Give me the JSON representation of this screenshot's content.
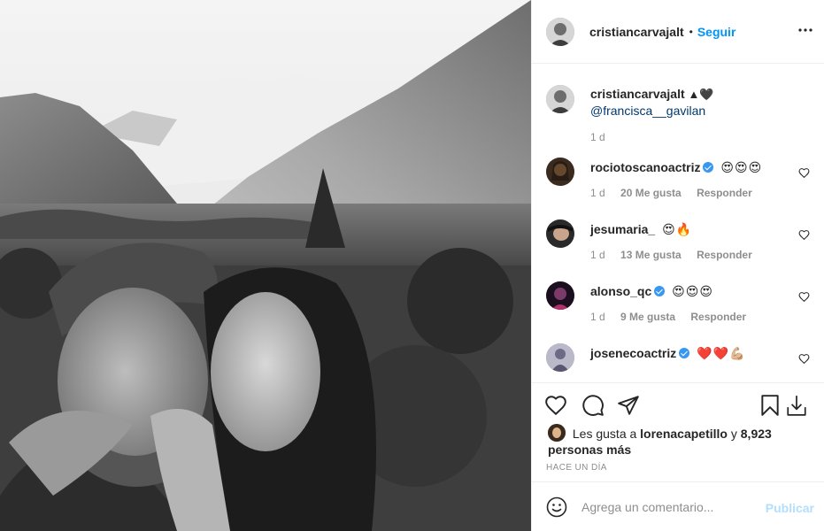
{
  "post": {
    "author": {
      "username": "cristiancarvajalt",
      "separator": "•",
      "follow_label": "Seguir"
    },
    "icons": {
      "more": "more-options-icon",
      "like": "heart-icon",
      "comment": "comment-bubble-icon",
      "share": "paper-plane-icon",
      "save": "bookmark-icon",
      "download": "download-icon",
      "emoji": "smiley-icon",
      "verified": "verified-badge-icon"
    },
    "caption": {
      "username": "cristiancarvajalt",
      "emoji": "▲🖤",
      "mention": "@francisca__gavilan",
      "time": "1 d"
    },
    "comments": [
      {
        "username": "rociotoscanoactriz",
        "verified": true,
        "text": "😍😍😍",
        "time": "1 d",
        "likes": "20 Me gusta",
        "reply": "Responder"
      },
      {
        "username": "jesumaria_",
        "verified": false,
        "text": "😍🔥",
        "time": "1 d",
        "likes": "13 Me gusta",
        "reply": "Responder"
      },
      {
        "username": "alonso_qc",
        "verified": true,
        "text": "😍😍😍",
        "time": "1 d",
        "likes": "9 Me gusta",
        "reply": "Responder"
      },
      {
        "username": "josenecoactriz",
        "verified": true,
        "text": "❤️❤️💪🏼",
        "time": "",
        "likes": "",
        "reply": ""
      }
    ],
    "liked_by": {
      "prefix": "Les gusta a",
      "user": "lorenacapetillo",
      "joiner": "y",
      "others": "8,923 personas más"
    },
    "time_ago": "HACE UN DÍA",
    "add_comment": {
      "placeholder": "Agrega un comentario...",
      "publish_label": "Publicar"
    },
    "colors": {
      "accent": "#0095f6",
      "publish_disabled": "#b2dffc",
      "verified": "#3897f0",
      "muted": "#8e8e8e"
    }
  }
}
